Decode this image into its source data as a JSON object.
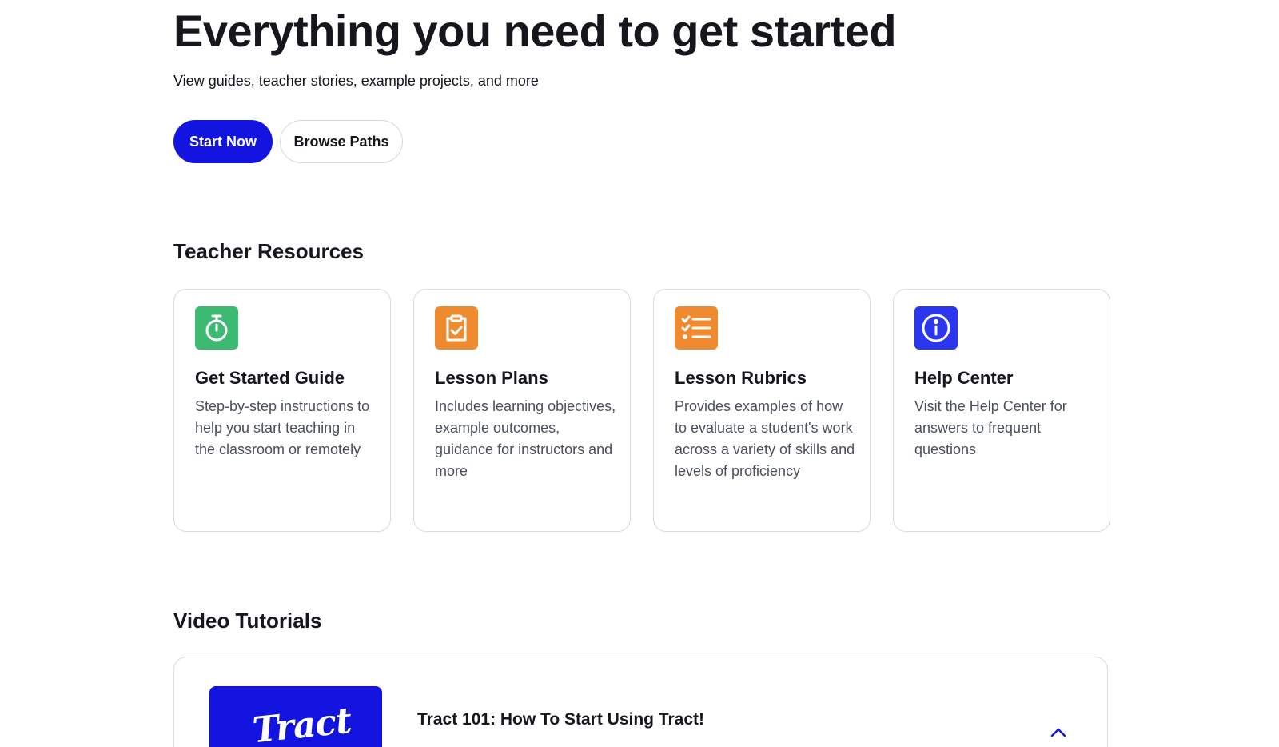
{
  "hero": {
    "title": "Everything you need to get started",
    "subtitle": "View guides, teacher stories, example projects, and more",
    "primary_button": "Start Now",
    "secondary_button": "Browse Paths"
  },
  "teacher_resources": {
    "heading": "Teacher Resources",
    "cards": [
      {
        "icon": "stopwatch-icon",
        "icon_color": "#3dba72",
        "title": "Get Started Guide",
        "description": "Step-by-step instructions to help you start teaching in the classroom or remotely"
      },
      {
        "icon": "clipboard-check-icon",
        "icon_color": "#f08a2e",
        "title": "Lesson Plans",
        "description": "Includes learning objectives, example outcomes, guidance for instructors and more"
      },
      {
        "icon": "checklist-icon",
        "icon_color": "#f08a2e",
        "title": "Lesson Rubrics",
        "description": "Provides examples of how to evaluate a student's work across a variety of skills and levels of proficiency"
      },
      {
        "icon": "info-icon",
        "icon_color": "#2b36ee",
        "title": "Help Center",
        "description": "Visit the Help Center for answers to frequent questions"
      }
    ]
  },
  "video_tutorials": {
    "heading": "Video Tutorials",
    "items": [
      {
        "thumbnail_logo": "Tract",
        "thumbnail_color": "#1414e0",
        "title": "Tract 101: How To Start Using Tract!",
        "expand_icon": "chevron-up-icon"
      }
    ]
  },
  "colors": {
    "primary": "#1414e0",
    "text": "#16161d",
    "muted_text": "#4a4f5c",
    "border": "#d9d9e0"
  }
}
